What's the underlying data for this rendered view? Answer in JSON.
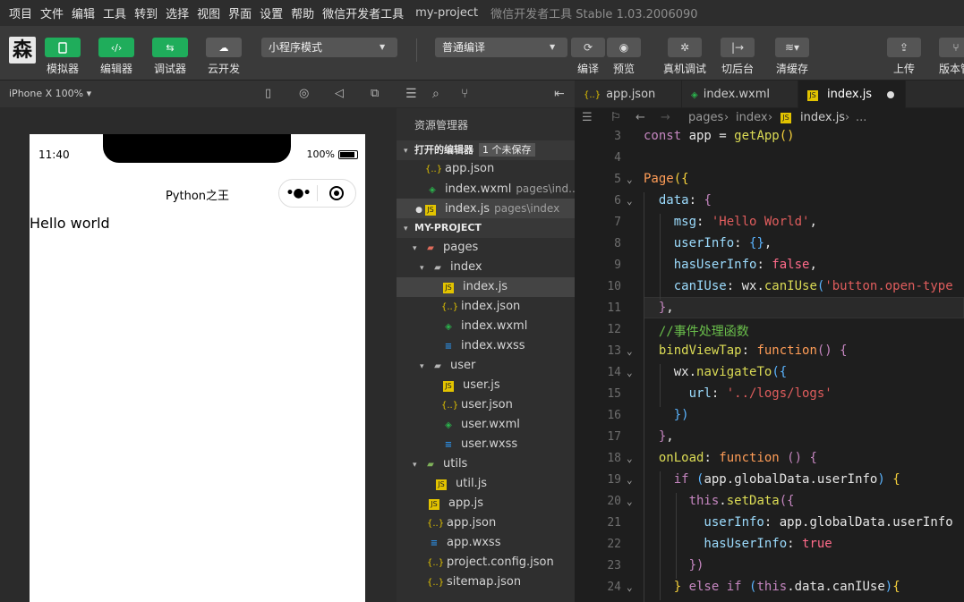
{
  "menu": {
    "items": [
      "项目",
      "文件",
      "编辑",
      "工具",
      "转到",
      "选择",
      "视图",
      "界面",
      "设置",
      "帮助",
      "微信开发者工具"
    ],
    "project": "my-project",
    "app_version": "微信开发者工具 Stable 1.03.2006090"
  },
  "toolbar": {
    "avatar_glyph": "森",
    "simulator": "模拟器",
    "editor": "编辑器",
    "debugger": "调试器",
    "cloud": "云开发",
    "mode_select": "小程序模式",
    "compile_select": "普通编译",
    "compile": "编译",
    "preview": "预览",
    "remote_debug": "真机调试",
    "background": "切后台",
    "clear_cache": "清缓存",
    "upload": "上传",
    "version": "版本管"
  },
  "simulator": {
    "device": "iPhone X 100% ▾",
    "time": "11:40",
    "battery": "100%",
    "nav_title": "Python之王",
    "capsule_menu": "•●•",
    "content": "Hello world"
  },
  "explorer": {
    "title": "资源管理器",
    "open_editors": "打开的编辑器",
    "unsaved": "1 个未保存",
    "open_files": [
      {
        "name": "app.json",
        "path": "",
        "type": "json"
      },
      {
        "name": "index.wxml",
        "path": "pages\\ind...",
        "type": "wxml"
      },
      {
        "name": "index.js",
        "path": "pages\\index",
        "type": "js"
      }
    ],
    "project": "MY-PROJECT",
    "tree": [
      {
        "name": "pages",
        "type": "folder-pages",
        "depth": 1,
        "caret": "▾"
      },
      {
        "name": "index",
        "type": "folder",
        "depth": 2,
        "caret": "▾"
      },
      {
        "name": "index.js",
        "type": "js",
        "depth": 3
      },
      {
        "name": "index.json",
        "type": "json",
        "depth": 3
      },
      {
        "name": "index.wxml",
        "type": "wxml",
        "depth": 3
      },
      {
        "name": "index.wxss",
        "type": "wxss",
        "depth": 3
      },
      {
        "name": "user",
        "type": "folder",
        "depth": 2,
        "caret": "▾"
      },
      {
        "name": "user.js",
        "type": "js",
        "depth": 3
      },
      {
        "name": "user.json",
        "type": "json",
        "depth": 3
      },
      {
        "name": "user.wxml",
        "type": "wxml",
        "depth": 3
      },
      {
        "name": "user.wxss",
        "type": "wxss",
        "depth": 3
      },
      {
        "name": "utils",
        "type": "folder-utils",
        "depth": 1,
        "caret": "▾"
      },
      {
        "name": "util.js",
        "type": "js",
        "depth": 2
      },
      {
        "name": "app.js",
        "type": "js",
        "depth": 1
      },
      {
        "name": "app.json",
        "type": "json",
        "depth": 1
      },
      {
        "name": "app.wxss",
        "type": "wxss",
        "depth": 1
      },
      {
        "name": "project.config.json",
        "type": "json",
        "depth": 1
      },
      {
        "name": "sitemap.json",
        "type": "json",
        "depth": 1
      }
    ]
  },
  "editor": {
    "tabs": [
      {
        "name": "app.json",
        "type": "json"
      },
      {
        "name": "index.wxml",
        "type": "wxml"
      },
      {
        "name": "index.js",
        "type": "js"
      }
    ],
    "breadcrumb": [
      "pages",
      "index",
      "index.js",
      "..."
    ],
    "line_numbers": [
      "3",
      "4",
      "5",
      "6",
      "7",
      "8",
      "9",
      "10",
      "11",
      "12",
      "13",
      "14",
      "15",
      "16",
      "17",
      "18",
      "19",
      "20",
      "21",
      "22",
      "23",
      "24"
    ],
    "lines": [
      {
        "t": [
          [
            "const ",
            "k"
          ],
          [
            "app ",
            "wh"
          ],
          [
            "= ",
            "wh"
          ],
          [
            "getApp",
            "fn"
          ],
          [
            "()",
            "yb"
          ]
        ]
      },
      {
        "t": []
      },
      {
        "t": [
          [
            "Page",
            "kw"
          ],
          [
            "({",
            "yb"
          ]
        ]
      },
      {
        "t": [
          [
            "  data",
            "prop"
          ],
          [
            ": ",
            "wh"
          ],
          [
            "{",
            "pb"
          ]
        ]
      },
      {
        "t": [
          [
            "    msg",
            "prop"
          ],
          [
            ": ",
            "wh"
          ],
          [
            "'Hello World'",
            "str"
          ],
          [
            ",",
            "wh"
          ]
        ]
      },
      {
        "t": [
          [
            "    userInfo",
            "prop"
          ],
          [
            ": ",
            "wh"
          ],
          [
            "{}",
            "bb"
          ],
          [
            ",",
            "wh"
          ]
        ]
      },
      {
        "t": [
          [
            "    hasUserInfo",
            "prop"
          ],
          [
            ": ",
            "wh"
          ],
          [
            "false",
            "bool"
          ],
          [
            ",",
            "wh"
          ]
        ]
      },
      {
        "t": [
          [
            "    canIUse",
            "prop"
          ],
          [
            ": ",
            "wh"
          ],
          [
            "wx",
            "wh"
          ],
          [
            ".",
            "wh"
          ],
          [
            "canIUse",
            "fn"
          ],
          [
            "(",
            "bb"
          ],
          [
            "'button.open-type",
            "str"
          ]
        ]
      },
      {
        "t": [
          [
            "  }",
            "pb"
          ],
          [
            ",",
            "wh"
          ]
        ]
      },
      {
        "t": [
          [
            "  //事件处理函数",
            "cmt"
          ]
        ]
      },
      {
        "t": [
          [
            "  bindViewTap",
            "fn"
          ],
          [
            ": ",
            "wh"
          ],
          [
            "function",
            "kw"
          ],
          [
            "() ",
            "pb"
          ],
          [
            "{",
            "pb"
          ]
        ]
      },
      {
        "t": [
          [
            "    wx",
            "wh"
          ],
          [
            ".",
            "wh"
          ],
          [
            "navigateTo",
            "fn"
          ],
          [
            "({",
            "bb"
          ]
        ]
      },
      {
        "t": [
          [
            "      url",
            "prop"
          ],
          [
            ": ",
            "wh"
          ],
          [
            "'../logs/logs'",
            "str"
          ]
        ]
      },
      {
        "t": [
          [
            "    })",
            "bb"
          ]
        ]
      },
      {
        "t": [
          [
            "  }",
            "pb"
          ],
          [
            ",",
            "wh"
          ]
        ]
      },
      {
        "t": [
          [
            "  onLoad",
            "fn"
          ],
          [
            ": ",
            "wh"
          ],
          [
            "function ",
            "kw"
          ],
          [
            "() ",
            "pb"
          ],
          [
            "{",
            "pb"
          ]
        ]
      },
      {
        "t": [
          [
            "    if ",
            "k"
          ],
          [
            "(",
            "bb"
          ],
          [
            "app",
            "wh"
          ],
          [
            ".",
            "wh"
          ],
          [
            "globalData",
            "wh"
          ],
          [
            ".",
            "wh"
          ],
          [
            "userInfo",
            "wh"
          ],
          [
            ") ",
            "bb"
          ],
          [
            "{",
            "yb"
          ]
        ]
      },
      {
        "t": [
          [
            "      this",
            "k"
          ],
          [
            ".",
            "wh"
          ],
          [
            "setData",
            "fn"
          ],
          [
            "({",
            "pb"
          ]
        ]
      },
      {
        "t": [
          [
            "        userInfo",
            "prop"
          ],
          [
            ": ",
            "wh"
          ],
          [
            "app",
            "wh"
          ],
          [
            ".",
            "wh"
          ],
          [
            "globalData",
            "wh"
          ],
          [
            ".",
            "wh"
          ],
          [
            "userInfo",
            "wh"
          ]
        ]
      },
      {
        "t": [
          [
            "        hasUserInfo",
            "prop"
          ],
          [
            ": ",
            "wh"
          ],
          [
            "true",
            "bool"
          ]
        ]
      },
      {
        "t": [
          [
            "      })",
            "pb"
          ]
        ]
      },
      {
        "t": [
          [
            "    } ",
            "yb"
          ],
          [
            "else ",
            "k"
          ],
          [
            "if ",
            "k"
          ],
          [
            "(",
            "bb"
          ],
          [
            "this",
            "k"
          ],
          [
            ".",
            "wh"
          ],
          [
            "data",
            "wh"
          ],
          [
            ".",
            "wh"
          ],
          [
            "canIUse",
            "wh"
          ],
          [
            ")",
            "bb"
          ],
          [
            "{",
            "yb"
          ]
        ]
      }
    ]
  }
}
